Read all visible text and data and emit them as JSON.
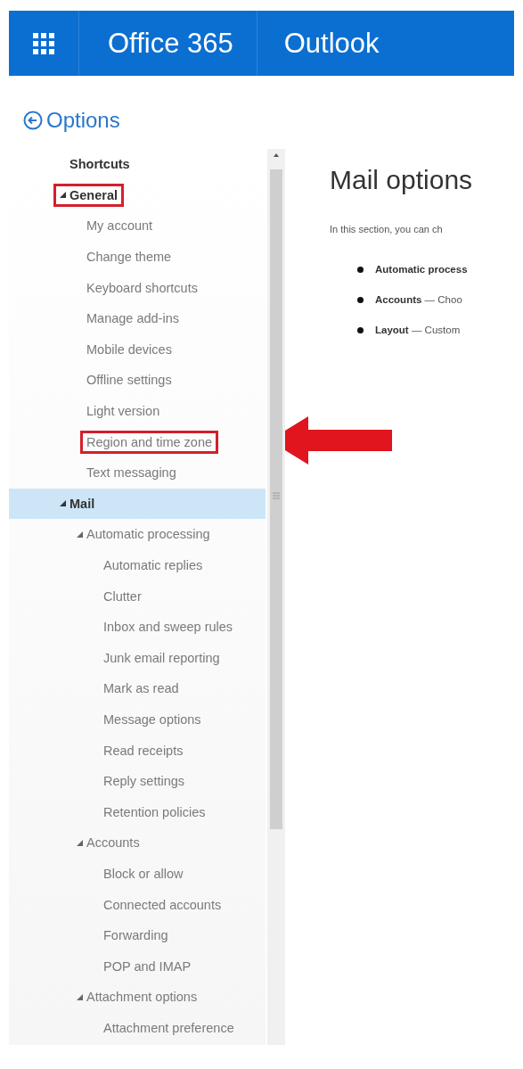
{
  "header": {
    "brand": "Office 365",
    "app": "Outlook"
  },
  "back": {
    "label": "Options"
  },
  "sidebar": {
    "items": [
      {
        "label": "Shortcuts",
        "selected": false
      },
      {
        "label": "General",
        "selected": false,
        "expanded": true,
        "annotated": true,
        "children": [
          {
            "label": "My account",
            "selected": false
          },
          {
            "label": "Change theme",
            "selected": false
          },
          {
            "label": "Keyboard shortcuts",
            "selected": false
          },
          {
            "label": "Manage add-ins",
            "selected": false
          },
          {
            "label": "Mobile devices",
            "selected": false
          },
          {
            "label": "Offline settings",
            "selected": false
          },
          {
            "label": "Light version",
            "selected": false
          },
          {
            "label": "Region and time zone",
            "selected": false,
            "annotated": true,
            "pointed": true
          },
          {
            "label": "Text messaging",
            "selected": false
          }
        ]
      },
      {
        "label": "Mail",
        "selected": true,
        "expanded": true,
        "children": [
          {
            "label": "Automatic processing",
            "selected": false,
            "expanded": true,
            "children": [
              {
                "label": "Automatic replies",
                "selected": false
              },
              {
                "label": "Clutter",
                "selected": false
              },
              {
                "label": "Inbox and sweep rules",
                "selected": false
              },
              {
                "label": "Junk email reporting",
                "selected": false
              },
              {
                "label": "Mark as read",
                "selected": false
              },
              {
                "label": "Message options",
                "selected": false
              },
              {
                "label": "Read receipts",
                "selected": false
              },
              {
                "label": "Reply settings",
                "selected": false
              },
              {
                "label": "Retention policies",
                "selected": false
              }
            ]
          },
          {
            "label": "Accounts",
            "selected": false,
            "expanded": true,
            "children": [
              {
                "label": "Block or allow",
                "selected": false
              },
              {
                "label": "Connected accounts",
                "selected": false
              },
              {
                "label": "Forwarding",
                "selected": false
              },
              {
                "label": "POP and IMAP",
                "selected": false
              }
            ]
          },
          {
            "label": "Attachment options",
            "selected": false,
            "expanded": true,
            "children": [
              {
                "label": "Attachment preference",
                "selected": false
              }
            ]
          }
        ]
      }
    ]
  },
  "main": {
    "title": "Mail options",
    "intro": "In this section, you can ch",
    "bullets": [
      "**Automatic process**",
      "**Accounts** — Choo",
      "**Layout** — Custom"
    ]
  }
}
